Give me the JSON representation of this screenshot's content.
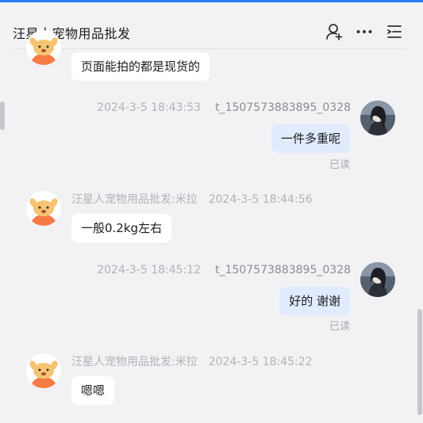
{
  "header": {
    "title": "汪星人宠物用品批发",
    "icons": [
      "add-person-icon",
      "more-icon",
      "list-icon"
    ]
  },
  "colors": {
    "accent": "#2f7cf6",
    "incoming_bubble": "#ffffff",
    "outgoing_bubble": "#e0ebfd",
    "background": "#f2f2f5"
  },
  "messages": [
    {
      "direction": "in",
      "text": "页面能拍的都是现货的"
    },
    {
      "direction": "out",
      "time": "2024-3-5 18:43:53",
      "sender": "t_1507573883895_0328",
      "text": "一件多重呢",
      "status": "已读"
    },
    {
      "direction": "in",
      "sender": "汪星人宠物用品批发:米拉",
      "time": "2024-3-5 18:44:56",
      "text": "一般0.2kg左右"
    },
    {
      "direction": "out",
      "time": "2024-3-5 18:45:12",
      "sender": "t_1507573883895_0328",
      "text": "好的 谢谢",
      "status": "已读"
    },
    {
      "direction": "in",
      "sender": "汪星人宠物用品批发:米拉",
      "time": "2024-3-5 18:45:22",
      "text": "嗯嗯"
    }
  ]
}
